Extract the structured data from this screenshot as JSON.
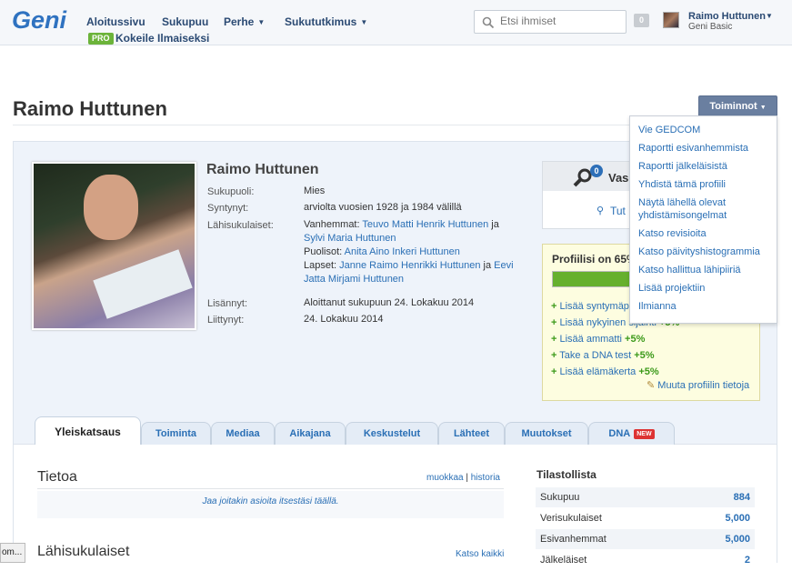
{
  "header": {
    "logo_text": "Geni",
    "nav": [
      {
        "label": "Aloitussivu",
        "dropdown": false
      },
      {
        "label": "Sukupuu",
        "dropdown": false
      },
      {
        "label": "Perhe",
        "dropdown": true
      },
      {
        "label": "Sukututkimus",
        "dropdown": true
      }
    ],
    "pro_badge": "PRO",
    "pro_link": "Kokeile Ilmaiseksi",
    "search_placeholder": "Etsi ihmiset",
    "notification_count": "0",
    "user_name": "Raimo Huttunen",
    "user_plan": "Geni Basic"
  },
  "page": {
    "title": "Raimo Huttunen",
    "actions_button": "Toiminnot",
    "actions_menu": [
      "Vie GEDCOM",
      "Raportti esivanhemmista",
      "Raportti jälkeläisistä",
      "Yhdistä tämä profiili",
      "Näytä lähellä olevat yhdistämisongelmat",
      "Katso revisioita",
      "Katso päivityshistogrammia",
      "Katso hallittua lähipiiriä",
      "Lisää projektiin",
      "Ilmianna"
    ]
  },
  "profile": {
    "name": "Raimo Huttunen",
    "gender_label": "Sukupuoli:",
    "gender": "Mies",
    "born_label": "Syntynyt:",
    "born": "arviolta vuosien 1928 ja 1984 välillä",
    "relatives_label": "Lähisukulaiset:",
    "parents_prefix": "Vanhemmat:",
    "parent1": "Teuvo Matti Henrik Huttunen",
    "and": "ja",
    "parent2": "Sylvi Maria Huttunen",
    "spouses_prefix": "Puolisot:",
    "spouse1": "Anita Aino Inkeri Huttunen",
    "children_prefix": "Lapset:",
    "child1": "Janne Raimo Henrikki Huttunen",
    "child2_a": "Eevi",
    "child2_b": "Jatta Mirjami Huttunen",
    "added_label": "Lisännyt:",
    "added": "Aloittanut sukupuun 24. Lokakuu 2014",
    "joined_label": "Liittynyt:",
    "joined": "24. Lokakuu 2014"
  },
  "matches": {
    "count": "0",
    "label": "Vas",
    "link": "Tut"
  },
  "completion": {
    "title": "Profiilisi on 65%",
    "progress": 0.65,
    "items": [
      {
        "label": "Lisää syntymäpä",
        "pct": ""
      },
      {
        "label": "Lisää nykyinen sijainti",
        "pct": "+5%"
      },
      {
        "label": "Lisää ammatti",
        "pct": "+5%"
      },
      {
        "label": "Take a DNA test",
        "pct": "+5%"
      },
      {
        "label": "Lisää elämäkerta",
        "pct": "+5%"
      }
    ],
    "edit_link": "Muuta profiilin tietoja"
  },
  "tabs": [
    {
      "label": "Yleiskatsaus",
      "active": true
    },
    {
      "label": "Toiminta"
    },
    {
      "label": "Mediaa"
    },
    {
      "label": "Aikajana"
    },
    {
      "label": "Keskustelut"
    },
    {
      "label": "Lähteet"
    },
    {
      "label": "Muutokset"
    },
    {
      "label": "DNA",
      "badge": "NEW"
    }
  ],
  "about": {
    "title": "Tietoa",
    "edit": "muokkaa",
    "sep": "|",
    "history": "historia",
    "empty": "Jaa joitakin asioita itsestäsi täällä."
  },
  "relatives_section": {
    "title": "Lähisukulaiset",
    "see_all": "Katso kaikki"
  },
  "stats": {
    "title": "Tilastollista",
    "rows": [
      {
        "label": "Sukupuu",
        "value": "884"
      },
      {
        "label": "Verisukulaiset",
        "value": "5,000"
      },
      {
        "label": "Esivanhemmat",
        "value": "5,000"
      },
      {
        "label": "Jälkeläiset",
        "value": "2"
      }
    ]
  },
  "left_chip": "om..."
}
